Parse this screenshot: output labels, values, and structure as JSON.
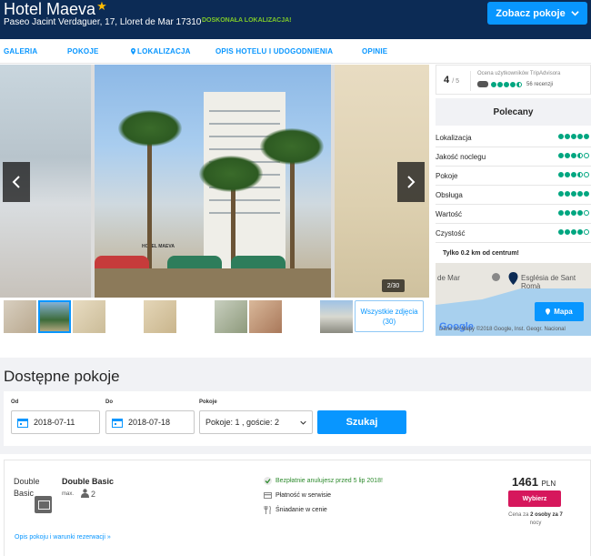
{
  "hotel": {
    "name": "Hotel Maeva",
    "star": "★",
    "address": "Paseo Jacint Verdaguer, 17, Lloret de Mar 17310",
    "badge": "DOSKONAŁA LOKALIZACJA!",
    "cta_label": "Zobacz pokoje"
  },
  "nav": {
    "items": [
      "GALERIA",
      "POKOJE",
      "LOKALIZACJA",
      "OPIS HOTELU I UDOGODNIENIA",
      "OPINIE"
    ]
  },
  "gallery": {
    "counter": "2/30",
    "all_photos_label": "Wszystkie zdjęcia (30)",
    "main_caption": "HOTEL MAEVA"
  },
  "ratings": {
    "score": "4",
    "score_of": "/ 5",
    "ta_label": "Ocena użytkowników TripAdvisora",
    "ta_reviews": "56 recenzji",
    "ta_value": 4.5,
    "recommended_label": "Polecany",
    "criteria": [
      {
        "label": "Lokalizacja",
        "value": 5
      },
      {
        "label": "Jakość noclegu",
        "value": 3.5
      },
      {
        "label": "Pokoje",
        "value": 3.5
      },
      {
        "label": "Obsługa",
        "value": 5
      },
      {
        "label": "Wartość",
        "value": 4
      },
      {
        "label": "Czystość",
        "value": 4
      }
    ],
    "center_distance": "Tylko 0.2 km od centrum!"
  },
  "map": {
    "label_left": "de Mar",
    "label_right": "Església de Sant Romà",
    "button_label": "Mapa",
    "google": "Google",
    "copyright": "Dane do Mapy ©2018 Google, Inst. Geogr. Nacional"
  },
  "availability": {
    "title": "Dostępne pokoje",
    "from_label": "Od",
    "from_value": "2018-07-11",
    "to_label": "Do",
    "to_value": "2018-07-18",
    "rooms_label": "Pokoje",
    "rooms_value": "Pokoje: 1 , goście: 2",
    "search_label": "Szukaj"
  },
  "room": {
    "image_alt": "Double Basic",
    "name": "Double Basic",
    "max_label": "max.",
    "max_count": "2",
    "features": [
      {
        "text": "Bezpłatnie anulujesz przed 5 lip 2018!",
        "icon": "check-icon",
        "free": true
      },
      {
        "text": "Płatność w serwisie",
        "icon": "card-icon",
        "free": false
      },
      {
        "text": "Śniadanie w cenie",
        "icon": "fork-knife-icon",
        "free": false
      }
    ],
    "price": "1461",
    "currency": "PLN",
    "select_label": "Wybierz",
    "price_note_1": "Cena za",
    "price_note_bold": "2 osoby za 7",
    "price_note_2": "nocy",
    "details_link": "Opis pokoju i warunki rezerwacji »"
  },
  "colors": {
    "header_bg": "#0c2b55",
    "accent": "#0896ff",
    "select_button": "#d6175c",
    "ta_green": "#00a680",
    "badge_green": "#7ec82a"
  }
}
